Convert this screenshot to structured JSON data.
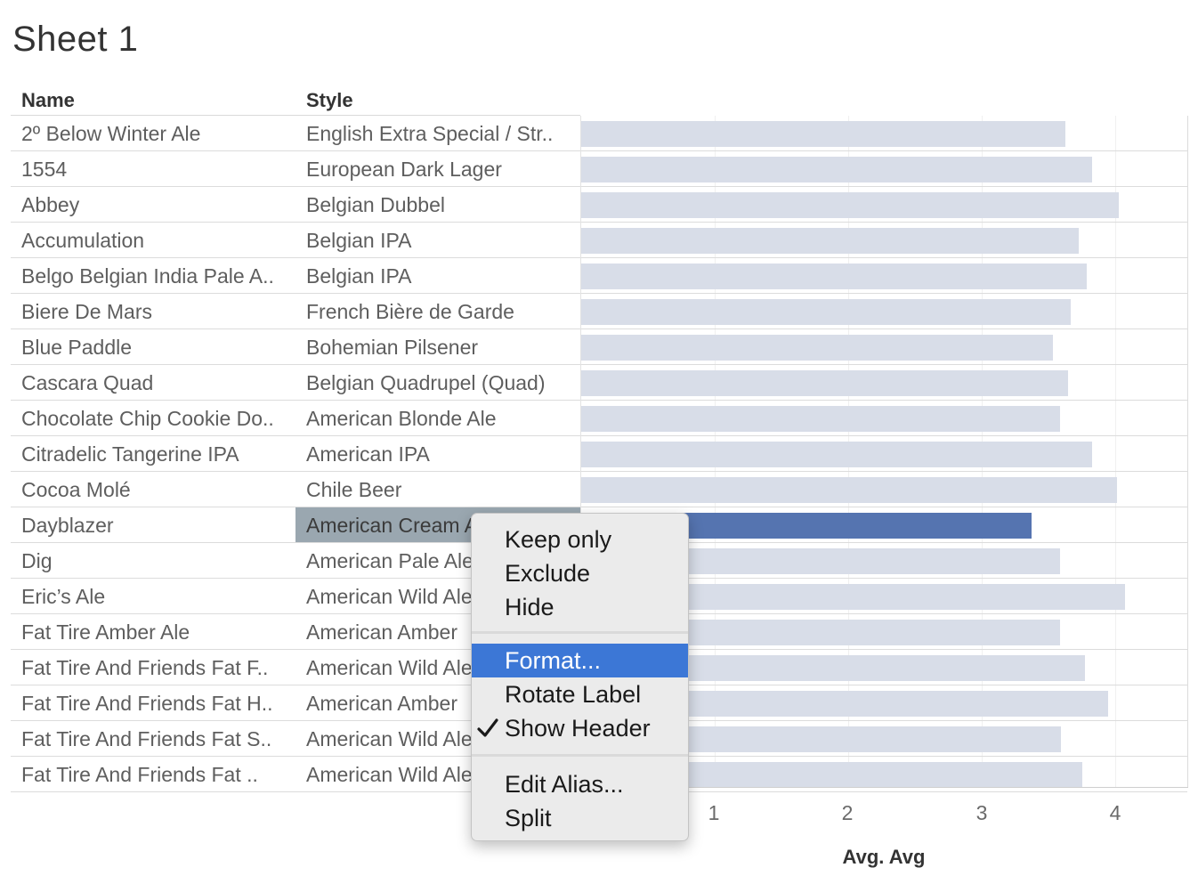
{
  "sheet": {
    "title": "Sheet 1"
  },
  "headers": {
    "name": "Name",
    "style": "Style"
  },
  "rows": [
    {
      "name": "2º Below Winter Ale",
      "style": "English Extra Special / Str..",
      "avg": 3.63
    },
    {
      "name": "1554",
      "style": "European Dark Lager",
      "avg": 3.83
    },
    {
      "name": "Abbey",
      "style": "Belgian Dubbel",
      "avg": 4.03
    },
    {
      "name": "Accumulation",
      "style": "Belgian IPA",
      "avg": 3.73
    },
    {
      "name": "Belgo Belgian India Pale A..",
      "style": "Belgian IPA",
      "avg": 3.79
    },
    {
      "name": "Biere De Mars",
      "style": "French Bière de Garde",
      "avg": 3.67
    },
    {
      "name": "Blue Paddle",
      "style": "Bohemian Pilsener",
      "avg": 3.54
    },
    {
      "name": "Cascara Quad",
      "style": "Belgian Quadrupel (Quad)",
      "avg": 3.65
    },
    {
      "name": "Chocolate Chip Cookie Do..",
      "style": "American Blonde Ale",
      "avg": 3.59
    },
    {
      "name": "Citradelic Tangerine IPA",
      "style": "American IPA",
      "avg": 3.83
    },
    {
      "name": "Cocoa Molé",
      "style": "Chile Beer",
      "avg": 4.02
    },
    {
      "name": "Dayblazer",
      "style": "American Cream Ale",
      "avg": 3.38
    },
    {
      "name": "Dig",
      "style": "American Pale Ale",
      "avg": 3.59
    },
    {
      "name": "Eric’s Ale",
      "style": "American Wild Ale",
      "avg": 4.08
    },
    {
      "name": "Fat Tire Amber Ale",
      "style": "American Amber",
      "avg": 3.59
    },
    {
      "name": "Fat Tire And Friends Fat F..",
      "style": "American Wild Ale",
      "avg": 3.78
    },
    {
      "name": "Fat Tire And Friends Fat H..",
      "style": "American Amber",
      "avg": 3.95
    },
    {
      "name": "Fat Tire And Friends Fat S..",
      "style": "American Wild Ale",
      "avg": 3.6
    },
    {
      "name": "Fat Tire And Friends Fat ..",
      "style": "American Wild Ale",
      "avg": 3.76
    }
  ],
  "selected_row": 11,
  "axis": {
    "title": "Avg. Avg",
    "ticks": [
      "1",
      "2",
      "3",
      "4"
    ],
    "max": 4.5
  },
  "context_menu": {
    "groups": [
      [
        "Keep only",
        "Exclude",
        "Hide"
      ],
      [
        "Format...",
        "Rotate Label",
        "Show Header"
      ],
      [
        "Edit Alias...",
        "Split"
      ]
    ],
    "highlighted": "Format...",
    "checked": "Show Header"
  },
  "colors": {
    "bar": "#d8dde8",
    "bar_selected": "#5574b0",
    "menu_highlight": "#3c77d6",
    "selected_cell": "#9aa7b0"
  }
}
